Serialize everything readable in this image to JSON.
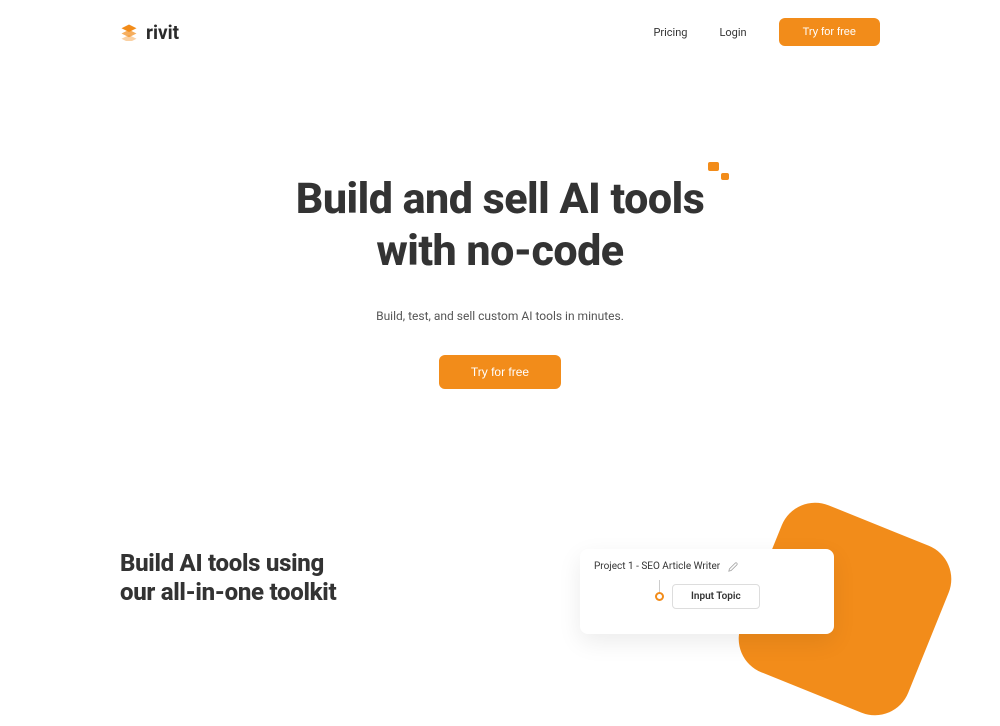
{
  "brand": {
    "name": "rivit"
  },
  "nav": {
    "pricing": "Pricing",
    "login": "Login",
    "cta": "Try for free"
  },
  "hero": {
    "title_line1": "Build and sell AI tools",
    "title_line2": "with no-code",
    "subtitle": "Build, test, and sell custom AI tools in minutes.",
    "cta": "Try for free"
  },
  "section2": {
    "title_line1": "Build AI tools using",
    "title_line2": "our all-in-one toolkit"
  },
  "preview": {
    "project_title": "Project 1 - SEO Article Writer",
    "node_label": "Input Topic"
  }
}
